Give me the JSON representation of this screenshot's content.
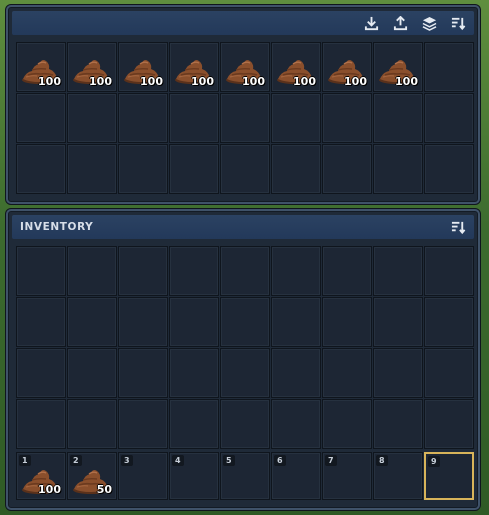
{
  "container": {
    "title": "",
    "actions": [
      "download-icon",
      "upload-icon",
      "layers-icon",
      "sort-icon"
    ],
    "slots": [
      {
        "item": "dirt-pile",
        "qty": "100"
      },
      {
        "item": "dirt-pile",
        "qty": "100"
      },
      {
        "item": "dirt-pile",
        "qty": "100"
      },
      {
        "item": "dirt-pile",
        "qty": "100"
      },
      {
        "item": "dirt-pile",
        "qty": "100"
      },
      {
        "item": "dirt-pile",
        "qty": "100"
      },
      {
        "item": "dirt-pile",
        "qty": "100"
      },
      {
        "item": "dirt-pile",
        "qty": "100"
      },
      {},
      {},
      {},
      {},
      {},
      {},
      {},
      {},
      {},
      {},
      {},
      {},
      {},
      {},
      {},
      {},
      {},
      {},
      {}
    ]
  },
  "inventory": {
    "title": "INVENTORY",
    "actions": [
      "sort-icon"
    ],
    "rows": 4,
    "hotbar": [
      {
        "key": "1",
        "item": "dirt-pile",
        "qty": "100"
      },
      {
        "key": "2",
        "item": "dirt-pile",
        "qty": "50"
      },
      {
        "key": "3"
      },
      {
        "key": "4"
      },
      {
        "key": "5"
      },
      {
        "key": "6"
      },
      {
        "key": "7"
      },
      {
        "key": "8"
      },
      {
        "key": "9",
        "selected": true
      }
    ]
  },
  "colors": {
    "panel": "#1f2a38",
    "header": "#23395a",
    "slot": "#1d2634",
    "selected": "#d8b45a",
    "dirt": "#8a4f2c"
  }
}
